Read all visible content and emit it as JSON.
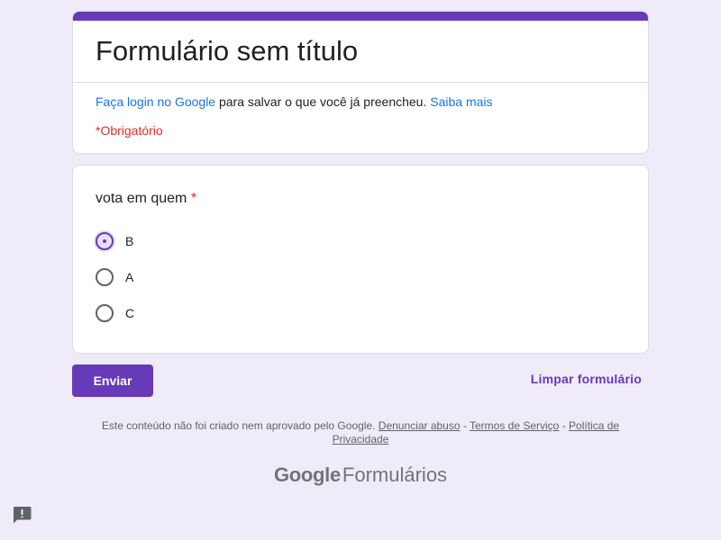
{
  "header": {
    "form_title": "Formulário sem título",
    "login_link": "Faça login no Google",
    "login_text": " para salvar o que você já preencheu. ",
    "learn_more": "Saiba mais",
    "required_note": "*Obrigatório",
    "accent_color": "#673ab7"
  },
  "question": {
    "title": "vota em quem",
    "required_mark": "*",
    "options": [
      {
        "label": "B",
        "selected": true
      },
      {
        "label": "A",
        "selected": false
      },
      {
        "label": "C",
        "selected": false
      }
    ]
  },
  "actions": {
    "submit_label": "Enviar",
    "clear_label": "Limpar formulário"
  },
  "footer": {
    "note": "Este conteúdo não foi criado nem aprovado pelo Google. ",
    "report_abuse": "Denunciar abuso",
    "sep1": " - ",
    "terms": "Termos de Serviço",
    "sep2": " - ",
    "privacy": "Política de Privacidade",
    "brand_google": "Google",
    "brand_forms": "Formulários"
  },
  "icons": {
    "feedback": "feedback-icon"
  }
}
